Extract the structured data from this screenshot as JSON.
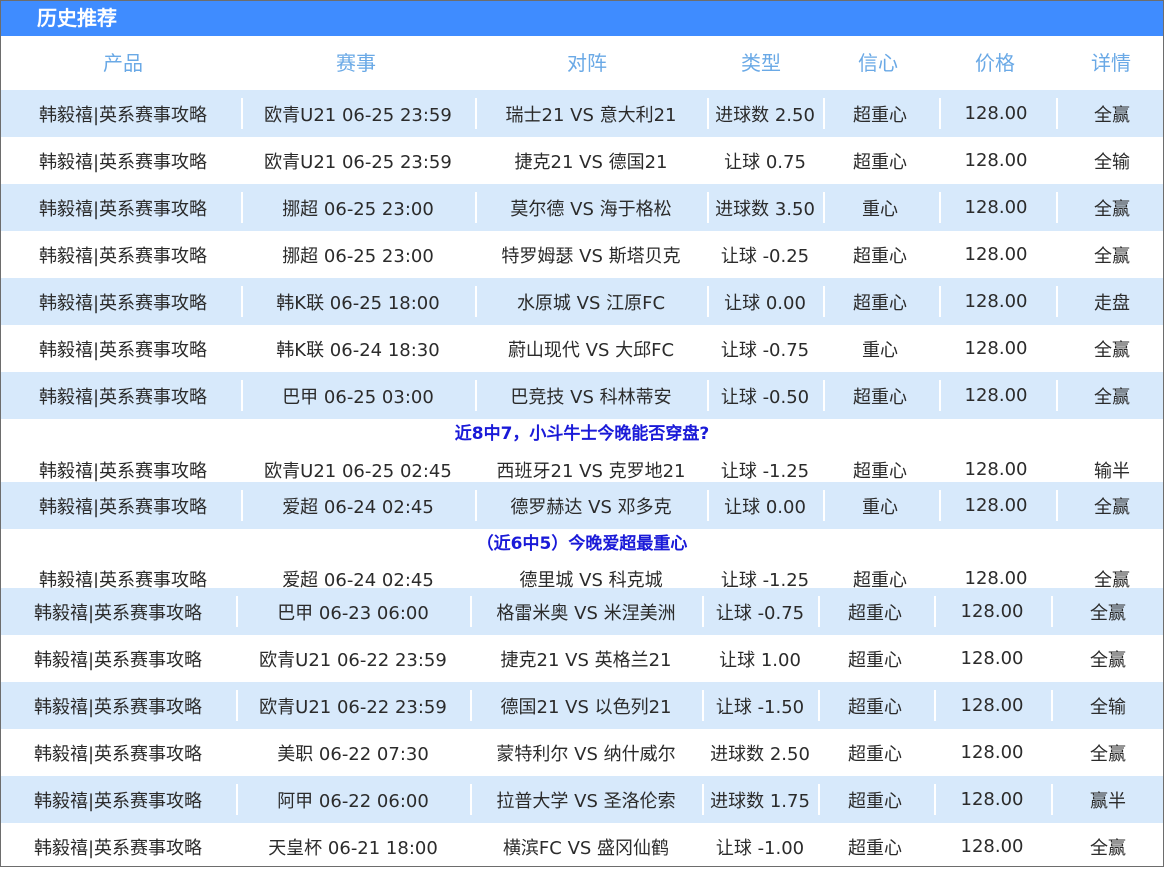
{
  "title": "历史推荐",
  "columns": [
    "产品",
    "赛事",
    "对阵",
    "类型",
    "信心",
    "价格",
    "详情"
  ],
  "rows": [
    {
      "product": "韩毅禧|英系赛事攻略",
      "event": "欧青U21 06-25 23:59",
      "match": "瑞士21 VS 意大利21",
      "type": "进球数 2.50",
      "confidence": "超重心",
      "price": "128.00",
      "result": "全赢"
    },
    {
      "product": "韩毅禧|英系赛事攻略",
      "event": "欧青U21 06-25 23:59",
      "match": "捷克21 VS 德国21",
      "type": "让球 0.75",
      "confidence": "超重心",
      "price": "128.00",
      "result": "全输"
    },
    {
      "product": "韩毅禧|英系赛事攻略",
      "event": "挪超 06-25 23:00",
      "match": "莫尔德 VS 海于格松",
      "type": "进球数 3.50",
      "confidence": "重心",
      "price": "128.00",
      "result": "全赢"
    },
    {
      "product": "韩毅禧|英系赛事攻略",
      "event": "挪超 06-25 23:00",
      "match": "特罗姆瑟 VS 斯塔贝克",
      "type": "让球 -0.25",
      "confidence": "超重心",
      "price": "128.00",
      "result": "全赢"
    },
    {
      "product": "韩毅禧|英系赛事攻略",
      "event": "韩K联 06-25 18:00",
      "match": "水原城 VS 江原FC",
      "type": "让球 0.00",
      "confidence": "超重心",
      "price": "128.00",
      "result": "走盘"
    },
    {
      "product": "韩毅禧|英系赛事攻略",
      "event": "韩K联 06-24 18:30",
      "match": "蔚山现代 VS 大邱FC",
      "type": "让球 -0.75",
      "confidence": "重心",
      "price": "128.00",
      "result": "全赢"
    },
    {
      "product": "韩毅禧|英系赛事攻略",
      "event": "巴甲 06-25 03:00",
      "match": "巴竞技 VS 科林蒂安",
      "type": "让球 -0.50",
      "confidence": "超重心",
      "price": "128.00",
      "result": "全赢"
    },
    {
      "product": "韩毅禧|英系赛事攻略",
      "event": "欧青U21 06-25 02:45",
      "match": "西班牙21 VS 克罗地21",
      "type": "让球 -1.25",
      "confidence": "超重心",
      "price": "128.00",
      "result": "输半"
    },
    {
      "product": "韩毅禧|英系赛事攻略",
      "event": "爱超 06-24 02:45",
      "match": "德罗赫达 VS 邓多克",
      "type": "让球 0.00",
      "confidence": "重心",
      "price": "128.00",
      "result": "全赢"
    },
    {
      "product": "韩毅禧|英系赛事攻略",
      "event": "爱超 06-24 02:45",
      "match": "德里城 VS 科克城",
      "type": "让球 -1.25",
      "confidence": "超重心",
      "price": "128.00",
      "result": "全赢"
    },
    {
      "product": "韩毅禧|英系赛事攻略",
      "event": "巴甲 06-23 06:00",
      "match": "格雷米奥 VS 米涅美洲",
      "type": "让球 -0.75",
      "confidence": "超重心",
      "price": "128.00",
      "result": "全赢"
    },
    {
      "product": "韩毅禧|英系赛事攻略",
      "event": "欧青U21 06-22 23:59",
      "match": "捷克21 VS 英格兰21",
      "type": "让球 1.00",
      "confidence": "超重心",
      "price": "128.00",
      "result": "全赢"
    },
    {
      "product": "韩毅禧|英系赛事攻略",
      "event": "欧青U21 06-22 23:59",
      "match": "德国21 VS 以色列21",
      "type": "让球 -1.50",
      "confidence": "超重心",
      "price": "128.00",
      "result": "全输"
    },
    {
      "product": "韩毅禧|英系赛事攻略",
      "event": "美职 06-22 07:30",
      "match": "蒙特利尔 VS 纳什威尔",
      "type": "进球数 2.50",
      "confidence": "超重心",
      "price": "128.00",
      "result": "全赢"
    },
    {
      "product": "韩毅禧|英系赛事攻略",
      "event": "阿甲 06-22 06:00",
      "match": "拉普大学 VS 圣洛伦索",
      "type": "进球数 1.75",
      "confidence": "超重心",
      "price": "128.00",
      "result": "赢半"
    },
    {
      "product": "韩毅禧|英系赛事攻略",
      "event": "天皇杯 06-21 18:00",
      "match": "横滨FC VS 盛冈仙鹤",
      "type": "让球 -1.00",
      "confidence": "超重心",
      "price": "128.00",
      "result": "全赢"
    }
  ],
  "notes": [
    "近8中7，小斗牛士今晚能否穿盘?",
    "（近6中5）今晚爱超最重心"
  ],
  "colors": {
    "title_bar": "#3f8cff",
    "header_text": "#6aa9e6",
    "row_stripe": "#d7e9fb",
    "note_text": "#1a1ad8"
  }
}
